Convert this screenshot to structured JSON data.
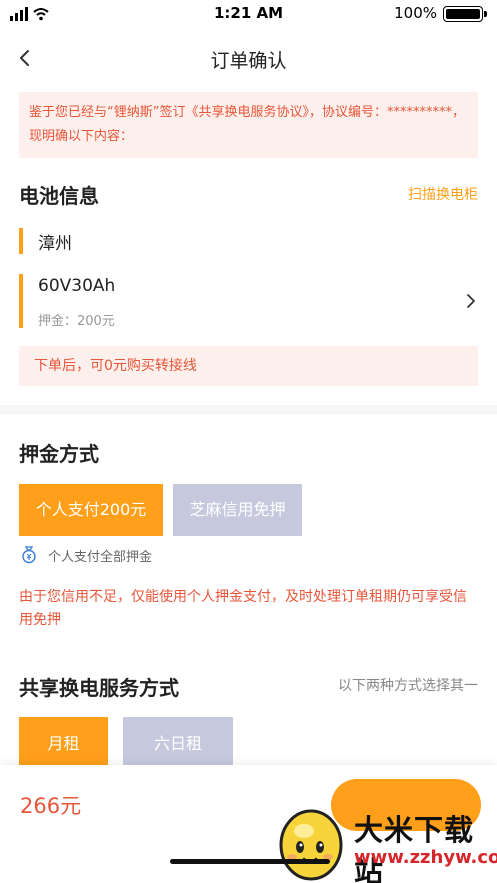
{
  "status_bar": {
    "time": "1:21 AM",
    "battery": "100%",
    "battery_level": 1.0
  },
  "nav": {
    "title": "订单确认"
  },
  "notice": {
    "text": "鉴于您已经与“锂纳斯”签订《共享换电服务协议》，协议编号：**********，现明确以下内容："
  },
  "battery_section": {
    "title": "电池信息",
    "scan_link": "扫描换电柜",
    "city": "漳州",
    "model": "60V30Ah",
    "deposit": "押金：200元",
    "promo": "下单后，可0元购买转接线"
  },
  "deposit_section": {
    "title": "押金方式",
    "options": [
      "个人支付200元",
      "芝麻信用免押"
    ],
    "selected": 0,
    "note": "个人支付全部押金",
    "warning": "由于您信用不足，仅能使用个人押金支付，及时处理订单租期仍可享受信用免押"
  },
  "service_section": {
    "title": "共享换电服务方式",
    "hint": "以下两种方式选择其一",
    "options": [
      "月租",
      "六日租"
    ],
    "selected": 0
  },
  "footer": {
    "price": "266元"
  },
  "watermark": {
    "name": "大米下载站",
    "url": "www.zzhyw.com"
  },
  "colors": {
    "accent": "#ff9f1a",
    "warning": "#e8563a",
    "inactive": "#c6c9de"
  }
}
